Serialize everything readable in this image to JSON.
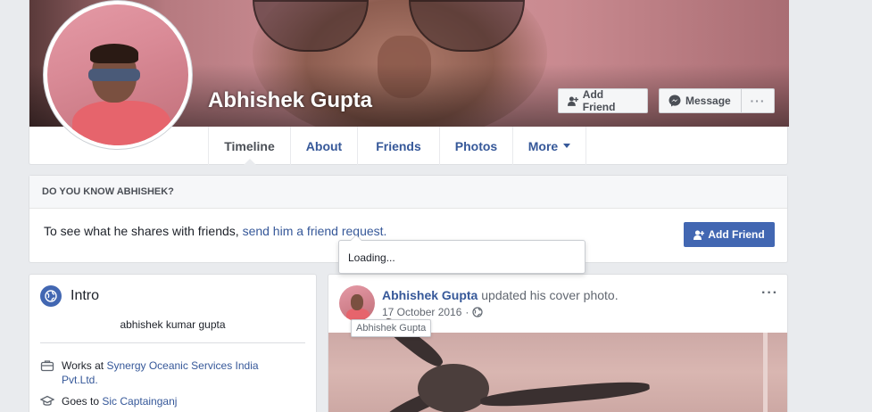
{
  "profile": {
    "name": "Abhishek Gupta",
    "add_friend_label": "Add Friend",
    "message_label": "Message",
    "more_label": "···"
  },
  "tabs": [
    {
      "label": "Timeline",
      "active": true
    },
    {
      "label": "About"
    },
    {
      "label": "Friends"
    },
    {
      "label": "Photos"
    },
    {
      "label": "More"
    }
  ],
  "know_card": {
    "heading": "DO YOU KNOW ABHISHEK?",
    "text": "To see what he shares with friends, ",
    "link": "send him a friend request.",
    "button_label": "Add Friend"
  },
  "loading_popup": {
    "text": "Loading..."
  },
  "intro": {
    "title": "Intro",
    "bio": "abhishek kumar gupta",
    "work_prefix": "Works at ",
    "work_place": "Synergy Oceanic Services India Pvt.Ltd.",
    "edu_prefix": "Goes to ",
    "edu_place": "Sic Captainganj"
  },
  "post": {
    "author": "Abhishek Gupta",
    "action": " updated his cover photo.",
    "date": "17 October 2016",
    "separator": "·",
    "more_label": "···",
    "tooltip": "Abhishek Gupta"
  },
  "colors": {
    "brand_blue": "#4267b2",
    "link_blue": "#365899",
    "page_bg": "#e9ebee"
  }
}
